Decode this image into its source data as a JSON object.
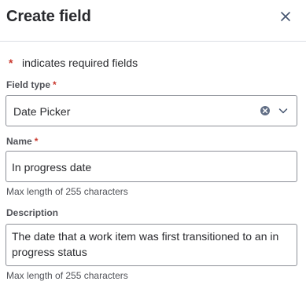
{
  "dialog": {
    "title": "Create field",
    "close_label": "Close"
  },
  "required_note": {
    "asterisk": "*",
    "text": "indicates required fields"
  },
  "field_type": {
    "label": "Field type",
    "asterisk": "*",
    "value": "Date Picker"
  },
  "name": {
    "label": "Name",
    "asterisk": "*",
    "value": "In progress date",
    "helper": "Max length of 255 characters"
  },
  "description": {
    "label": "Description",
    "value": "The date that a work item was first transitioned to an in progress status",
    "helper": "Max length of 255 characters"
  },
  "colors": {
    "required_asterisk": "#c9372c",
    "border": "#8c8f97",
    "text": "#292a2e",
    "subtle_text": "#505258"
  },
  "icons": {
    "close": "close-icon",
    "clear": "clear-icon",
    "dropdown": "chevron-down-icon"
  }
}
